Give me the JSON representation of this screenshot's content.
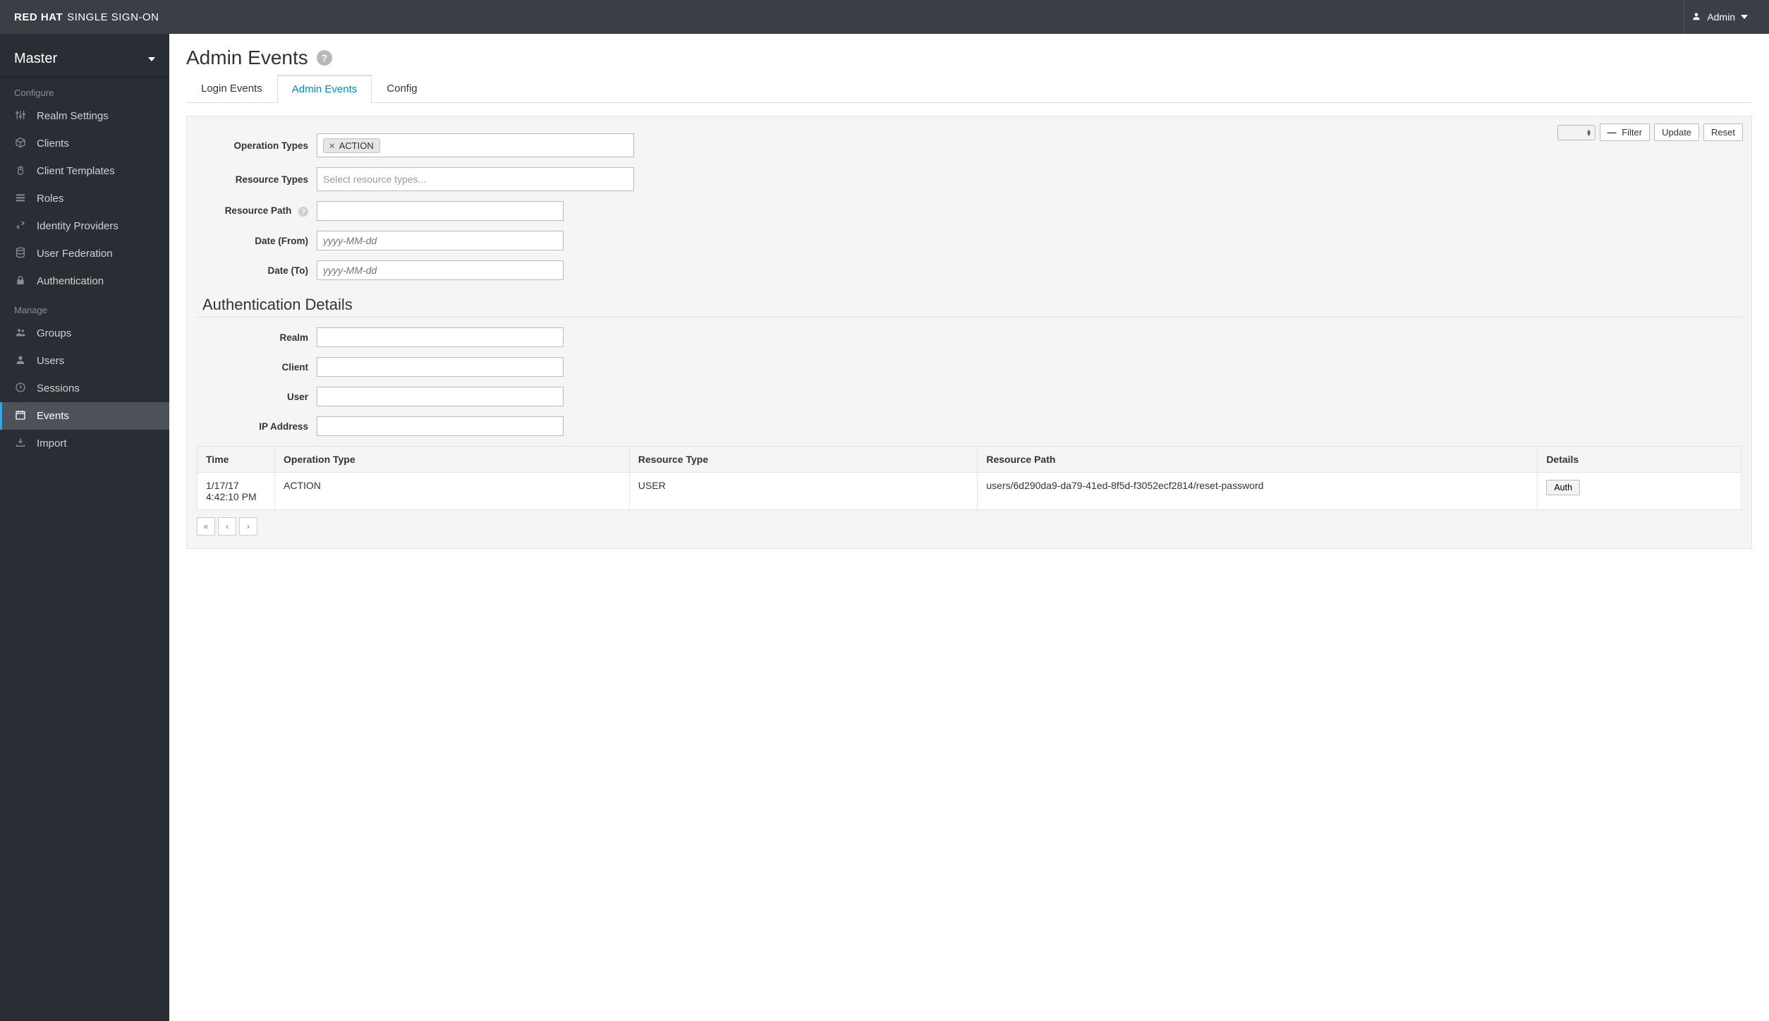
{
  "brand": {
    "red": "RED HAT",
    "rest": "SINGLE SIGN-ON"
  },
  "user": {
    "name": "Admin"
  },
  "realmSelector": {
    "current": "Master"
  },
  "sidebar": {
    "sections": [
      {
        "label": "Configure",
        "items": [
          {
            "label": "Realm Settings",
            "icon": "sliders"
          },
          {
            "label": "Clients",
            "icon": "cube"
          },
          {
            "label": "Client Templates",
            "icon": "cubes"
          },
          {
            "label": "Roles",
            "icon": "list"
          },
          {
            "label": "Identity Providers",
            "icon": "exchange"
          },
          {
            "label": "User Federation",
            "icon": "database"
          },
          {
            "label": "Authentication",
            "icon": "lock"
          }
        ]
      },
      {
        "label": "Manage",
        "items": [
          {
            "label": "Groups",
            "icon": "users"
          },
          {
            "label": "Users",
            "icon": "user"
          },
          {
            "label": "Sessions",
            "icon": "clock"
          },
          {
            "label": "Events",
            "icon": "calendar",
            "active": true
          },
          {
            "label": "Import",
            "icon": "import"
          }
        ]
      }
    ]
  },
  "page": {
    "title": "Admin Events"
  },
  "tabs": [
    {
      "label": "Login Events"
    },
    {
      "label": "Admin Events",
      "active": true
    },
    {
      "label": "Config"
    }
  ],
  "toolbar": {
    "filter": "Filter",
    "update": "Update",
    "reset": "Reset"
  },
  "form": {
    "labels": {
      "operationTypes": "Operation Types",
      "resourceTypes": "Resource Types",
      "resourcePath": "Resource Path",
      "dateFrom": "Date (From)",
      "dateTo": "Date (To)",
      "realm": "Realm",
      "client": "Client",
      "user": "User",
      "ip": "IP Address"
    },
    "operationTypesTag": "ACTION",
    "resourceTypesPlaceholder": "Select resource types...",
    "datePlaceholder": "yyyy-MM-dd",
    "authDetailsHeading": "Authentication Details"
  },
  "table": {
    "headers": [
      "Time",
      "Operation Type",
      "Resource Type",
      "Resource Path",
      "Details"
    ],
    "rows": [
      {
        "time": "1/17/17 4:42:10 PM",
        "op": "ACTION",
        "resType": "USER",
        "resPath": "users/6d290da9-da79-41ed-8f5d-f3052ecf2814/reset-password",
        "detailsBtn": "Auth"
      }
    ]
  }
}
